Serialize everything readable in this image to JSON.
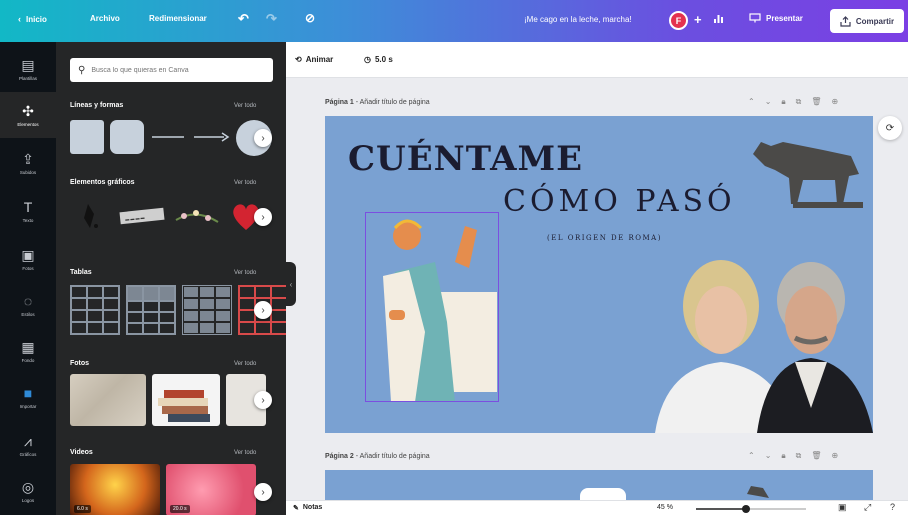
{
  "topbar": {
    "home_label": "Inicio",
    "file_label": "Archivo",
    "resize_label": "Redimensionar",
    "message": "¡Me cago en la leche, marcha!",
    "avatar_initial": "F",
    "present_label": "Presentar",
    "share_label": "Compartir"
  },
  "leftnav": [
    {
      "label": "Plantillas",
      "icon": "layout-icon"
    },
    {
      "label": "Elementos",
      "icon": "shapes-icon"
    },
    {
      "label": "Subidos",
      "icon": "upload-icon"
    },
    {
      "label": "Texto",
      "icon": "text-icon"
    },
    {
      "label": "Fotos",
      "icon": "photo-icon"
    },
    {
      "label": "Estilos",
      "icon": "palette-icon"
    },
    {
      "label": "Fondo",
      "icon": "background-icon"
    },
    {
      "label": "Importar",
      "icon": "import-icon"
    },
    {
      "label": "Gráficos",
      "icon": "chart-icon"
    },
    {
      "label": "Logos",
      "icon": "logo-icon"
    }
  ],
  "panel": {
    "search_placeholder": "Busca lo que quieras en Canva",
    "sections": [
      {
        "title": "Líneas y formas",
        "more": "Ver todo"
      },
      {
        "title": "Elementos gráficos",
        "more": "Ver todo"
      },
      {
        "title": "Tablas",
        "more": "Ver todo"
      },
      {
        "title": "Fotos",
        "more": "Ver todo"
      },
      {
        "title": "Videos",
        "more": "Ver todo"
      }
    ],
    "video_badges": [
      "6.0 s",
      "20.0 s"
    ]
  },
  "editor": {
    "animate_label": "Animar",
    "duration": "5.0 s",
    "page1_label": "Página 1",
    "page1_title_placeholder": " - Añadir título de página",
    "page2_label": "Página 2",
    "page2_title_placeholder": " - Añadir título de página"
  },
  "slide": {
    "title_line1": "CUÉNTAME",
    "title_line2": "CÓMO PASÓ",
    "subtitle": "(EL ORIGEN DE ROMA)"
  },
  "bottombar": {
    "notes_label": "Notas",
    "zoom": "45 %",
    "zoom_fraction": 0.45
  },
  "colors": {
    "slide_bg": "#7aa1d2",
    "selection": "#7b4fe0",
    "share_text": "#3a3a55"
  }
}
